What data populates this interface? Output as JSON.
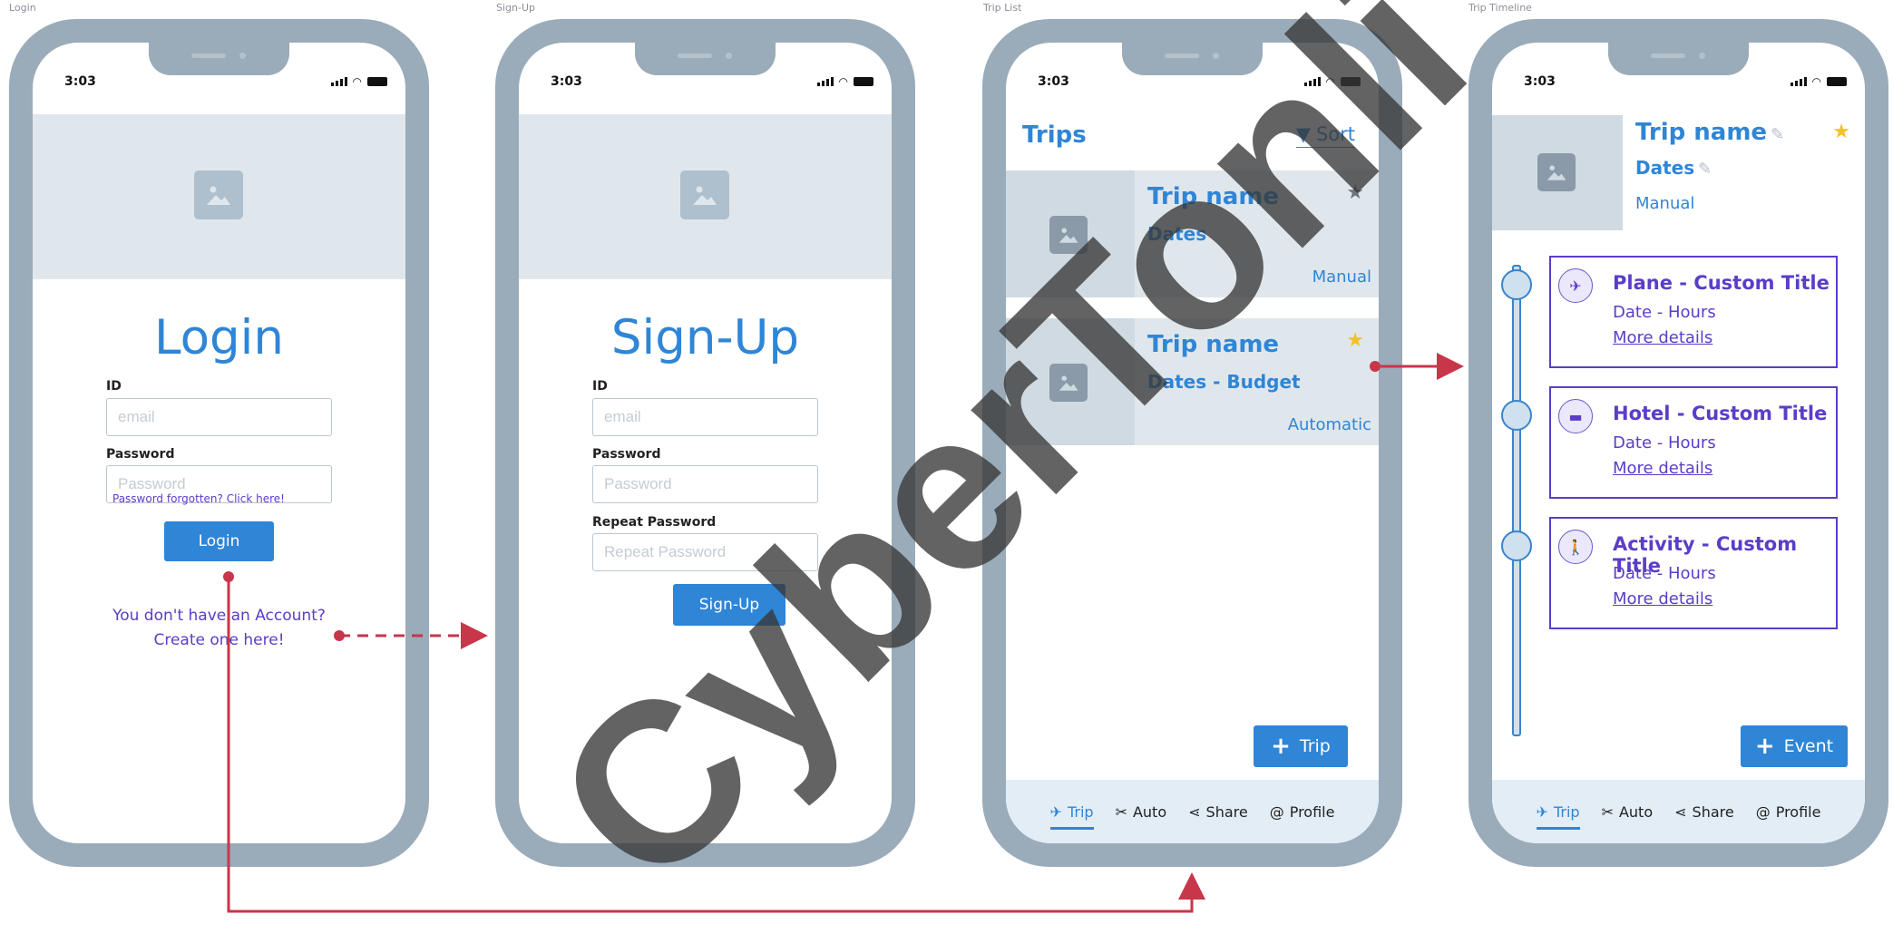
{
  "frame_labels": {
    "login": "Login",
    "signup": "Sign-Up",
    "triplist": "Trip List",
    "timeline": "Trip Timeline"
  },
  "status_bar": {
    "time": "3:03"
  },
  "login": {
    "title": "Login",
    "id_label": "ID",
    "id_placeholder": "email",
    "password_label": "Password",
    "password_placeholder": "Password",
    "forgot_link": "Password forgotten? Click here!",
    "button": "Login",
    "create_line1": "You don't have an Account?",
    "create_line2": "Create one here!"
  },
  "signup": {
    "title": "Sign-Up",
    "id_label": "ID",
    "id_placeholder": "email",
    "password_label": "Password",
    "password_placeholder": "Password",
    "repeat_label": "Repeat Password",
    "repeat_placeholder": "Repeat Password",
    "button": "Sign-Up"
  },
  "triplist": {
    "header": "Trips",
    "sort": "Sort",
    "cards": [
      {
        "name": "Trip name",
        "dates": "Dates",
        "mode": "Manual",
        "starred": false
      },
      {
        "name": "Trip name",
        "dates": "Dates - Budget",
        "mode": "Automatic",
        "starred": true
      }
    ],
    "add_button": "Trip"
  },
  "tabs": [
    "Trip",
    "Auto",
    "Share",
    "Profile"
  ],
  "timeline": {
    "name": "Trip name",
    "dates": "Dates",
    "mode": "Manual",
    "events": [
      {
        "title": "Plane - Custom Title",
        "datetime": "Date - Hours",
        "more": "More details",
        "icon": "plane-icon"
      },
      {
        "title": "Hotel - Custom Title",
        "datetime": "Date - Hours",
        "more": "More details",
        "icon": "bed-icon"
      },
      {
        "title": "Activity - Custom Title",
        "datetime": "Date - Hours",
        "more": "More details",
        "icon": "walking-person-icon"
      }
    ],
    "add_button": "Event"
  },
  "watermark": "CyberTonli",
  "colors": {
    "phone_frame": "#9aabba",
    "primary": "#2f85d6",
    "link_purple": "#5b3dc8",
    "placeholder_bg": "#e0e7ec",
    "flow_arrow": "#c8364a",
    "star_active": "#f5c02c",
    "star_inactive": "#6b7480"
  }
}
